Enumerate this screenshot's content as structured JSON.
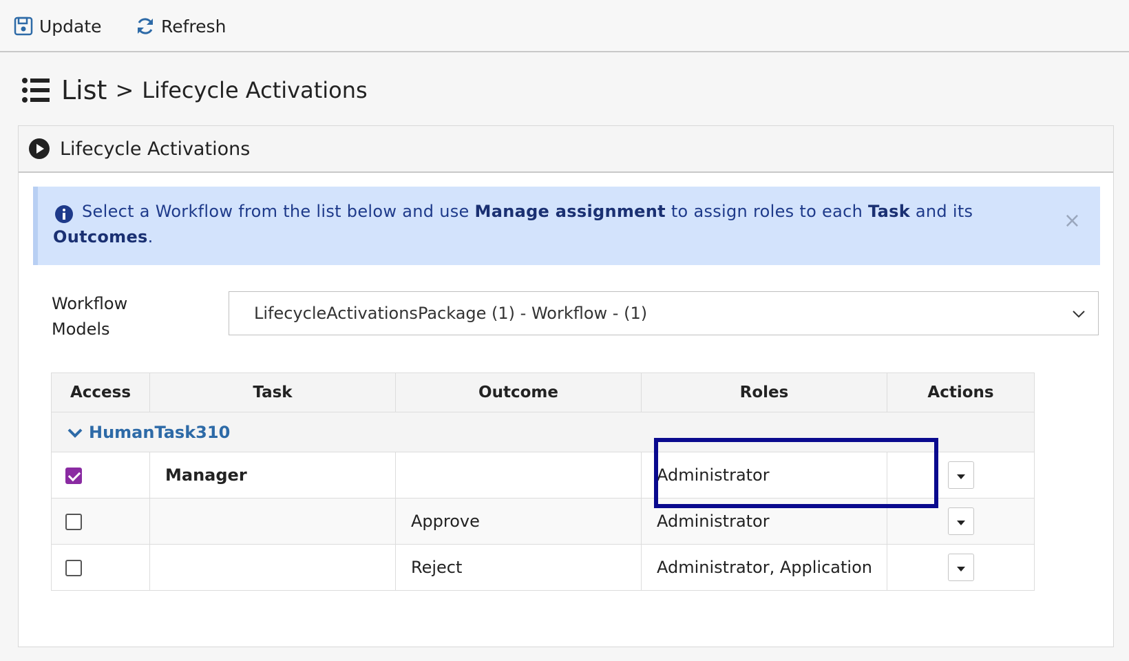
{
  "toolbar": {
    "update_label": "Update",
    "refresh_label": "Refresh"
  },
  "breadcrumb": {
    "list_label": "List",
    "separator": ">",
    "current": "Lifecycle Activations"
  },
  "panel": {
    "title": "Lifecycle Activations"
  },
  "alert": {
    "text_1": "Select a Workflow from the list below and use ",
    "bold_1": "Manage assignment",
    "text_2": " to assign roles to each ",
    "bold_2": "Task",
    "text_3": " and its ",
    "bold_3": "Outcomes",
    "text_4": ".",
    "close": "×"
  },
  "workflow": {
    "label": "Workflow Models",
    "selected": "LifecycleActivationsPackage (1) - Workflow - (1)"
  },
  "table": {
    "columns": [
      "Access",
      "Task",
      "Outcome",
      "Roles",
      "Actions"
    ],
    "group": "HumanTask310",
    "rows": [
      {
        "access": true,
        "task": "Manager",
        "outcome": "",
        "roles": "Administrator"
      },
      {
        "access": false,
        "task": "",
        "outcome": "Approve",
        "roles": "Administrator"
      },
      {
        "access": false,
        "task": "",
        "outcome": "Reject",
        "roles": "Administrator, Application"
      }
    ]
  },
  "colors": {
    "accent_purple": "#8a2ba2",
    "link_blue": "#2d6aa7",
    "alert_bg": "#d3e3fc",
    "highlight_border": "#0a0a8e"
  }
}
